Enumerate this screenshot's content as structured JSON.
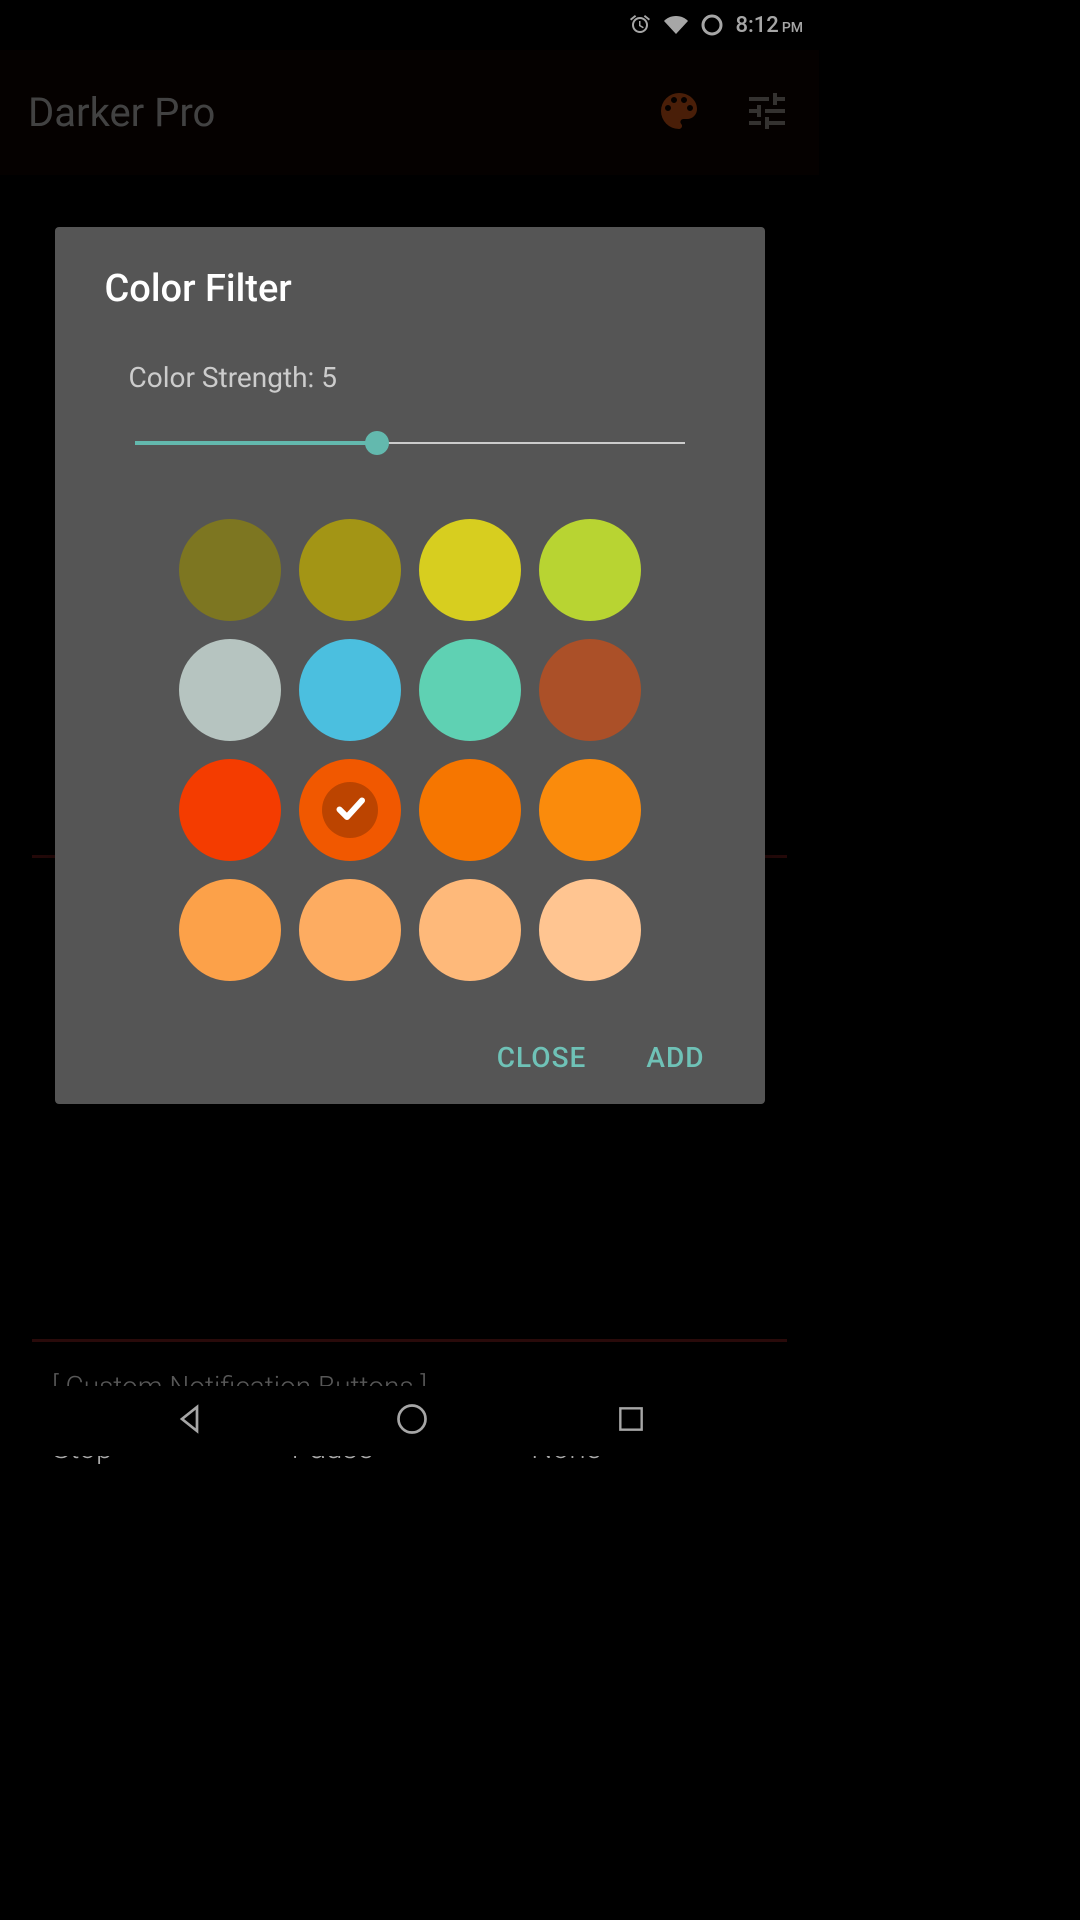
{
  "status": {
    "time": "8:12",
    "ampm": "PM"
  },
  "header": {
    "title": "Darker Pro"
  },
  "dialog": {
    "title": "Color Filter",
    "strength_label": "Color Strength: 5",
    "slider_value": 5,
    "close_label": "CLOSE",
    "add_label": "ADD",
    "selected_index": 9,
    "colors": [
      {
        "hex": "#7d7621"
      },
      {
        "hex": "#a39515"
      },
      {
        "hex": "#d7ce1f"
      },
      {
        "hex": "#b8d432"
      },
      {
        "hex": "#b6c4c0"
      },
      {
        "hex": "#4bbfdf"
      },
      {
        "hex": "#5fd1b3"
      },
      {
        "hex": "#ab5028"
      },
      {
        "hex": "#f43c00"
      },
      {
        "hex": "#f15800"
      },
      {
        "hex": "#f67600"
      },
      {
        "hex": "#fa8b0c"
      },
      {
        "hex": "#fca149"
      },
      {
        "hex": "#fdac61"
      },
      {
        "hex": "#feb97a"
      },
      {
        "hex": "#ffc591"
      }
    ]
  },
  "notification": {
    "label": "[ Custom Notification Buttons ]",
    "options": [
      "Stop",
      "Pause",
      "None"
    ]
  }
}
